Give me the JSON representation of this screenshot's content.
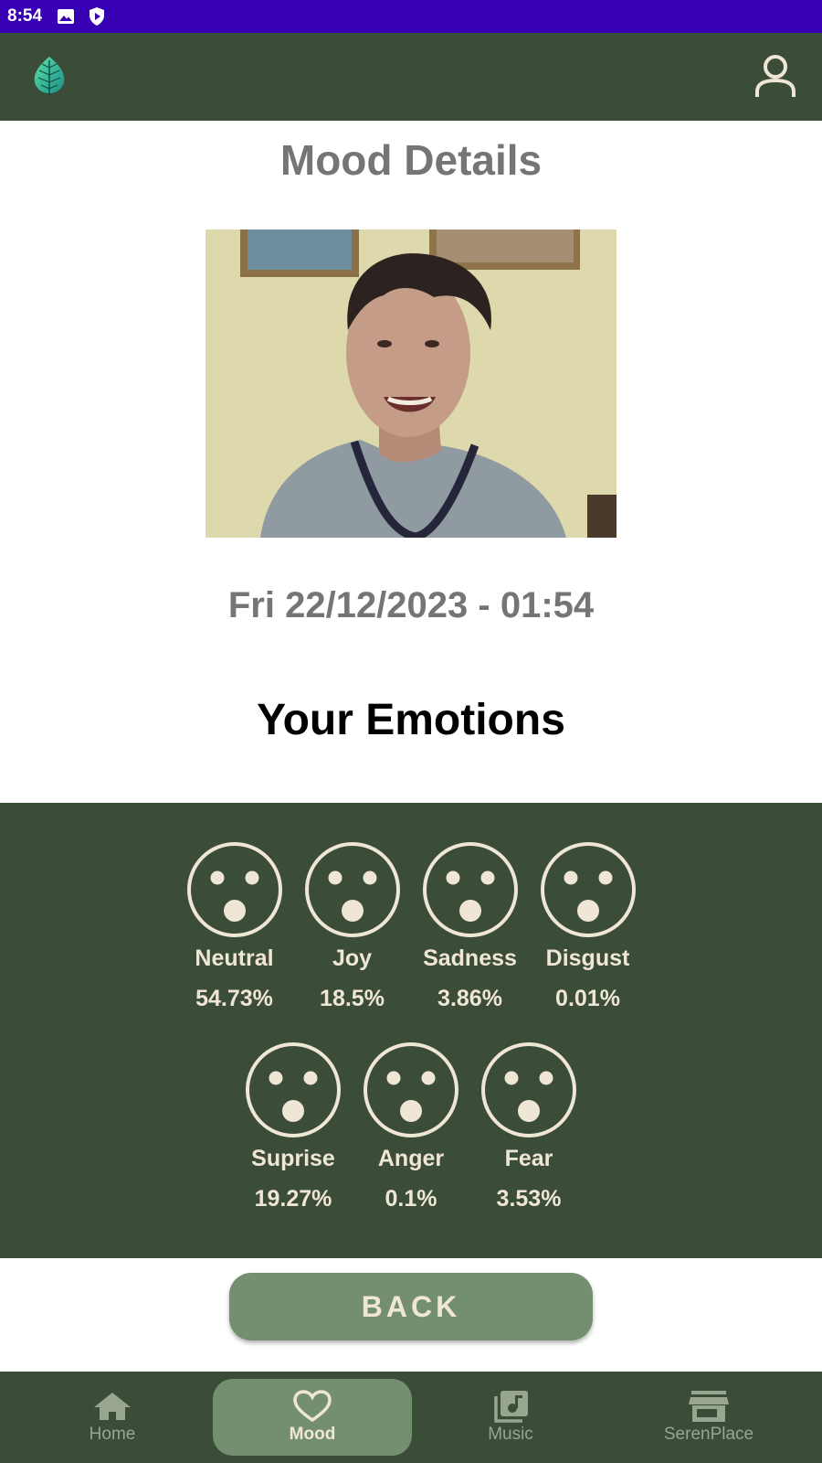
{
  "status_bar": {
    "time": "8:54"
  },
  "page": {
    "title": "Mood Details"
  },
  "photo": {
    "alt": "Mood photo"
  },
  "mood": {
    "date": "Fri 22/12/2023 - 01:54"
  },
  "emotions": {
    "title": "Your Emotions",
    "row1": [
      {
        "label": "Neutral",
        "value": "54.73%"
      },
      {
        "label": "Joy",
        "value": "18.5%"
      },
      {
        "label": "Sadness",
        "value": "3.86%"
      },
      {
        "label": "Disgust",
        "value": "0.01%"
      }
    ],
    "row2": [
      {
        "label": "Suprise",
        "value": "19.27%"
      },
      {
        "label": "Anger",
        "value": "0.1%"
      },
      {
        "label": "Fear",
        "value": "3.53%"
      }
    ]
  },
  "actions": {
    "back_label": "BACK"
  },
  "nav": {
    "home": "Home",
    "mood": "Mood",
    "music": "Music",
    "serenplace": "SerenPlace"
  },
  "colors": {
    "status_bar": "#3700b3",
    "primary_dark": "#3b4d38",
    "accent": "#748f70",
    "cream": "#efe6d6"
  }
}
